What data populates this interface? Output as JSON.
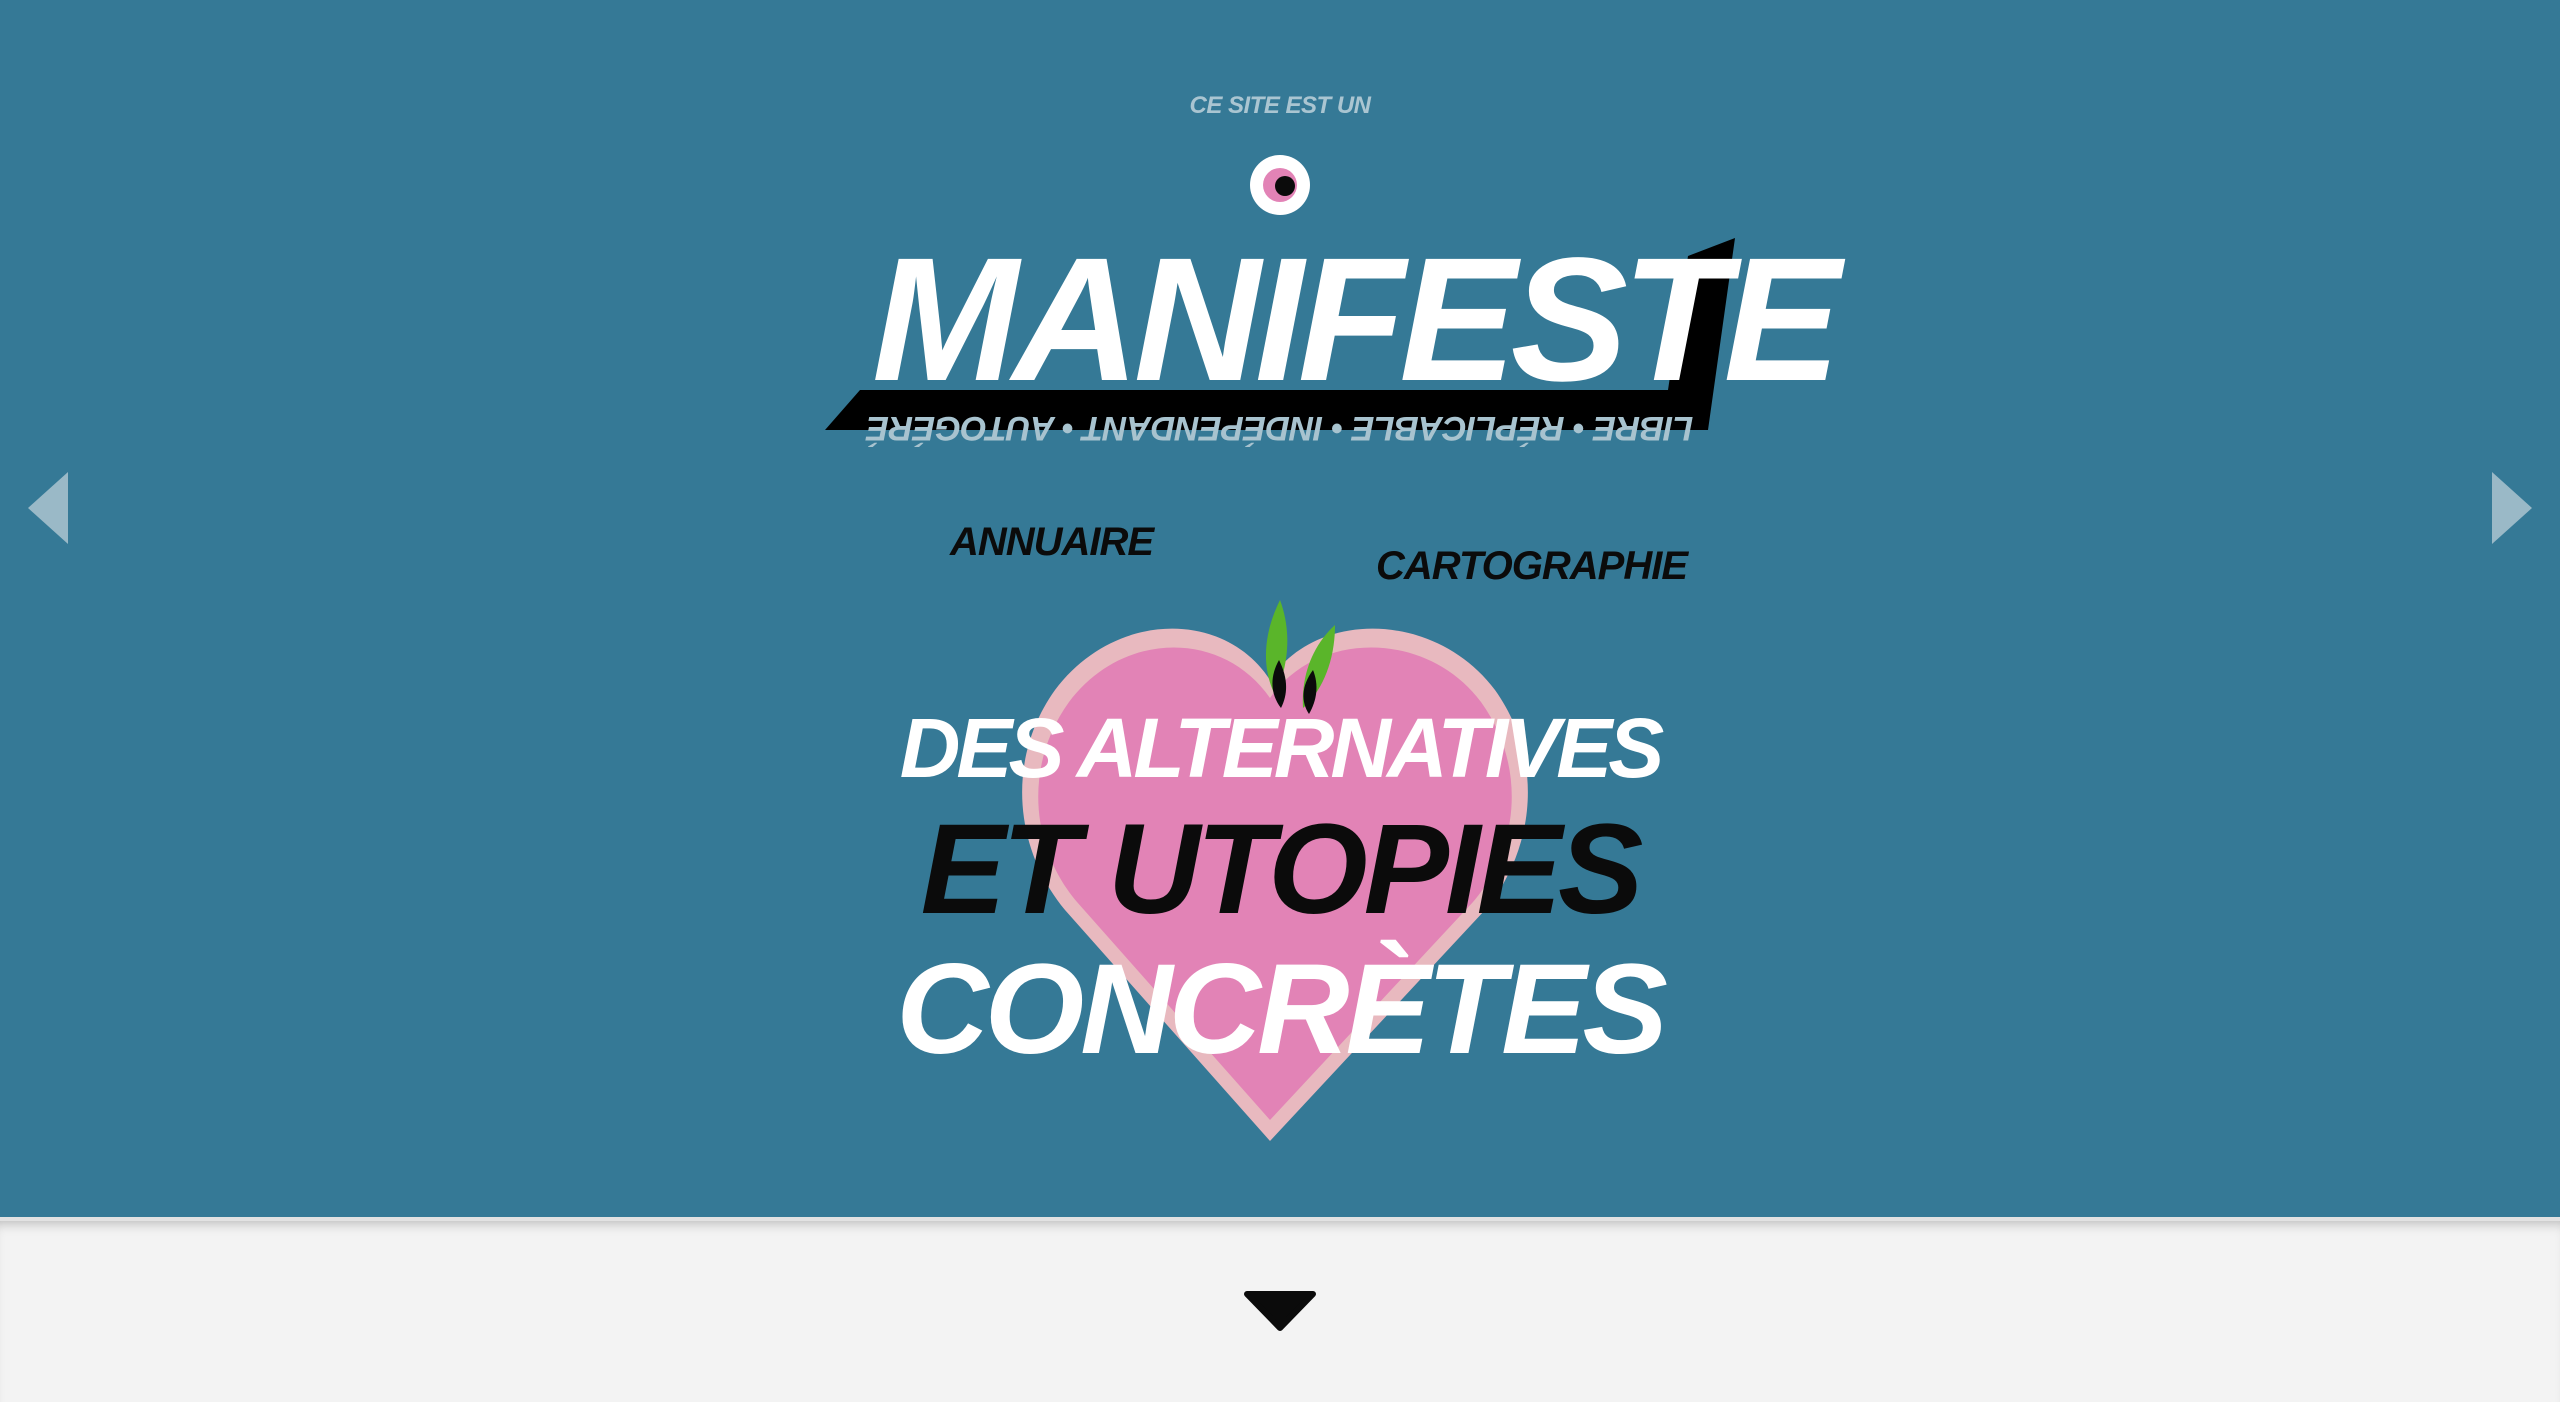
{
  "hero": {
    "intro": "CE SITE EST UN",
    "title": "MANIFESTE",
    "tagline": "LIBRE • RÉPLICABLE • INDÉPENDANT • AUTOGÉRÉ",
    "nav": {
      "annuaire": "ANNUAIRE",
      "cartographie": "CARTOGRAPHIE"
    },
    "slogan": {
      "line1": "DES ALTERNATIVES",
      "line2": "ET UTOPIES",
      "line3": "CONCRÈTES"
    },
    "icons": {
      "prev": "chevron-left-icon",
      "next": "chevron-right-icon",
      "eye": "eye-icon",
      "heart": "heart-icon",
      "scroll": "caret-down-icon"
    }
  },
  "colors": {
    "background": "#357996",
    "heart": "#e283b6",
    "heart_outline": "#e8b9bf",
    "sprout": "#5ab52a",
    "banner": "#000000",
    "footer": "#f3f3f3"
  }
}
